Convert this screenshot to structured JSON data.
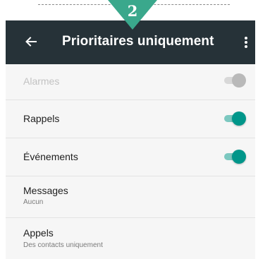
{
  "step_marker": {
    "number": "2",
    "color": "#3aa88c"
  },
  "appbar": {
    "back_icon": "arrow-left-icon",
    "title": "Prioritaires uniquement",
    "menu_icon": "more-vert-icon",
    "background": "#263238"
  },
  "settings": [
    {
      "label": "Alarmes",
      "toggle": "on",
      "enabled": false
    },
    {
      "label": "Rappels",
      "toggle": "on",
      "enabled": true
    },
    {
      "label": "Événements",
      "toggle": "on",
      "enabled": true
    },
    {
      "label": "Messages",
      "value": "Aucun"
    },
    {
      "label": "Appels",
      "value": "Des contacts uniquement"
    }
  ],
  "accent_color": "#00968a"
}
